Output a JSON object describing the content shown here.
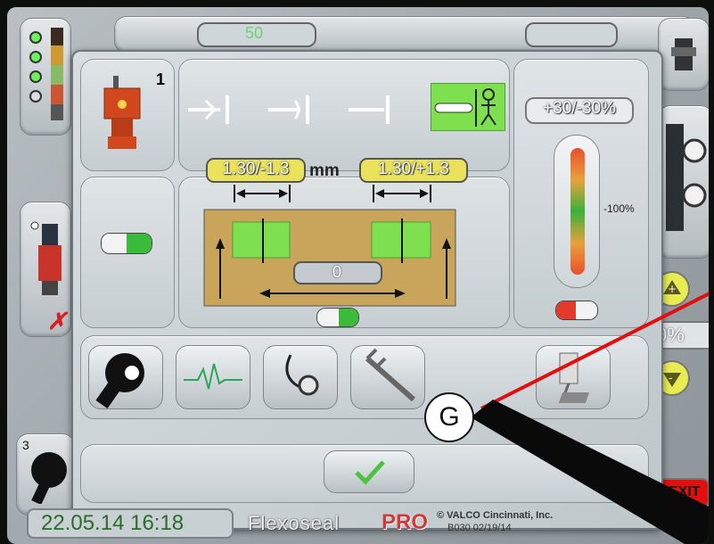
{
  "background": {
    "top_value": "50",
    "right_percent": "0%",
    "exit_label": "EXIT",
    "left_bottom_number": "3"
  },
  "dialog": {
    "product_number": "1",
    "tolerance_left": "1.30/-1.3",
    "unit": "mm",
    "tolerance_right": "1.30/+1.3",
    "distance_value": "0",
    "percent_range": "+30/-30%",
    "gauge_label": "-100%"
  },
  "toolbar": {
    "tools": [
      "settings-wrench-icon",
      "pulse-wave-icon",
      "stethoscope-icon",
      "caliper-icon",
      "nozzle-icon"
    ],
    "confirm_icon": "checkmark-icon"
  },
  "footer": {
    "datetime": "22.05.14 16:18",
    "brand_flexo": "Flexoseal",
    "brand_pro": "PRO",
    "company": "© VALCO Cincinnati, Inc.",
    "version": "B030 02/19/14"
  },
  "annotation": {
    "label": "G",
    "line_color": "#e01010"
  },
  "colors": {
    "tolerance_box": "#e9e25a",
    "product_area": "#c9a55c",
    "green_zone": "#7ee04f",
    "footer_green": "#2b6b2b",
    "pro_red": "#d23a3a",
    "exit_red": "#e01010"
  }
}
